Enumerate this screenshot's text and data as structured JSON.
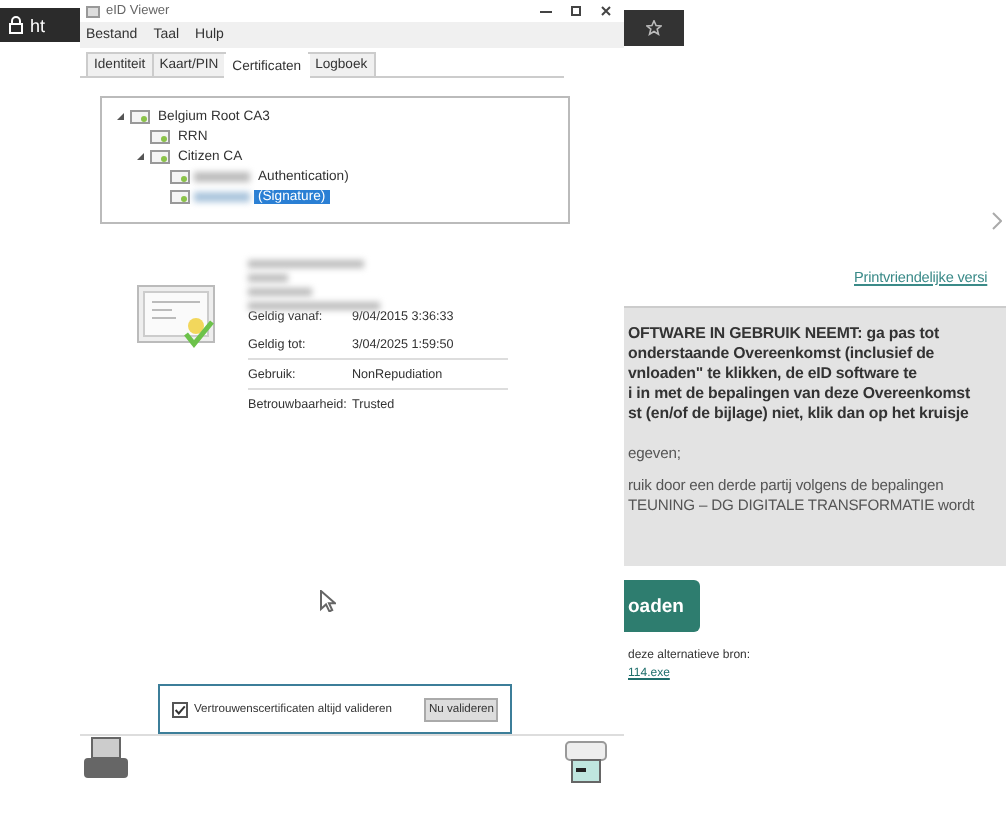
{
  "browser": {
    "address_fragment": "ht",
    "print_link": "Printvriendelijke versi",
    "agreement_paragraphs": [
      {
        "bold": true,
        "lines": [
          "OFTWARE IN GEBRUIK NEEMT: ga pas tot",
          "onderstaande Overeenkomst (inclusief  de",
          "vnloaden\" te klikken, de eID software te",
          "i in met de bepalingen van deze Overeenkomst",
          "st (en/of de bijlage) niet, klik dan op het kruisje"
        ]
      },
      {
        "bold": false,
        "lines": [
          "egeven;"
        ]
      },
      {
        "bold": false,
        "lines": [
          "ruik door een derde partij volgens de bepalingen",
          "TEUNING – DG DIGITALE TRANSFORMATIE wordt"
        ]
      }
    ],
    "download_button": "oaden",
    "alt_source_text": "deze alternatieve bron:",
    "alt_source_link": "114.exe"
  },
  "window": {
    "title": "eID Viewer",
    "menu": [
      "Bestand",
      "Taal",
      "Hulp"
    ],
    "tabs": [
      {
        "label": "Identiteit",
        "selected": false
      },
      {
        "label": "Kaart/PIN",
        "selected": false
      },
      {
        "label": "Certificaten",
        "selected": true
      },
      {
        "label": "Logboek",
        "selected": false
      }
    ],
    "tree": [
      {
        "label": "Belgium Root CA3",
        "expanded": true,
        "selected": false,
        "children": [
          {
            "label": "RRN",
            "selected": false
          },
          {
            "label": "Citizen CA",
            "expanded": true,
            "selected": false,
            "children": [
              {
                "label": "Authentication)",
                "selected": false
              },
              {
                "label": "(Signature)",
                "selected": true
              }
            ]
          }
        ]
      }
    ],
    "details": [
      {
        "label": "Geldig vanaf:",
        "value": "9/04/2015 3:36:33"
      },
      {
        "label": "Geldig tot:",
        "value": "3/04/2025 1:59:50"
      },
      {
        "label": "Gebruik:",
        "value": "NonRepudiation"
      },
      {
        "label": "Betrouwbaarheid:",
        "value": "Trusted"
      }
    ],
    "always_validate": {
      "label": "Vertrouwenscertificaten altijd valideren",
      "checked": true
    },
    "validate_button": "Nu valideren"
  }
}
